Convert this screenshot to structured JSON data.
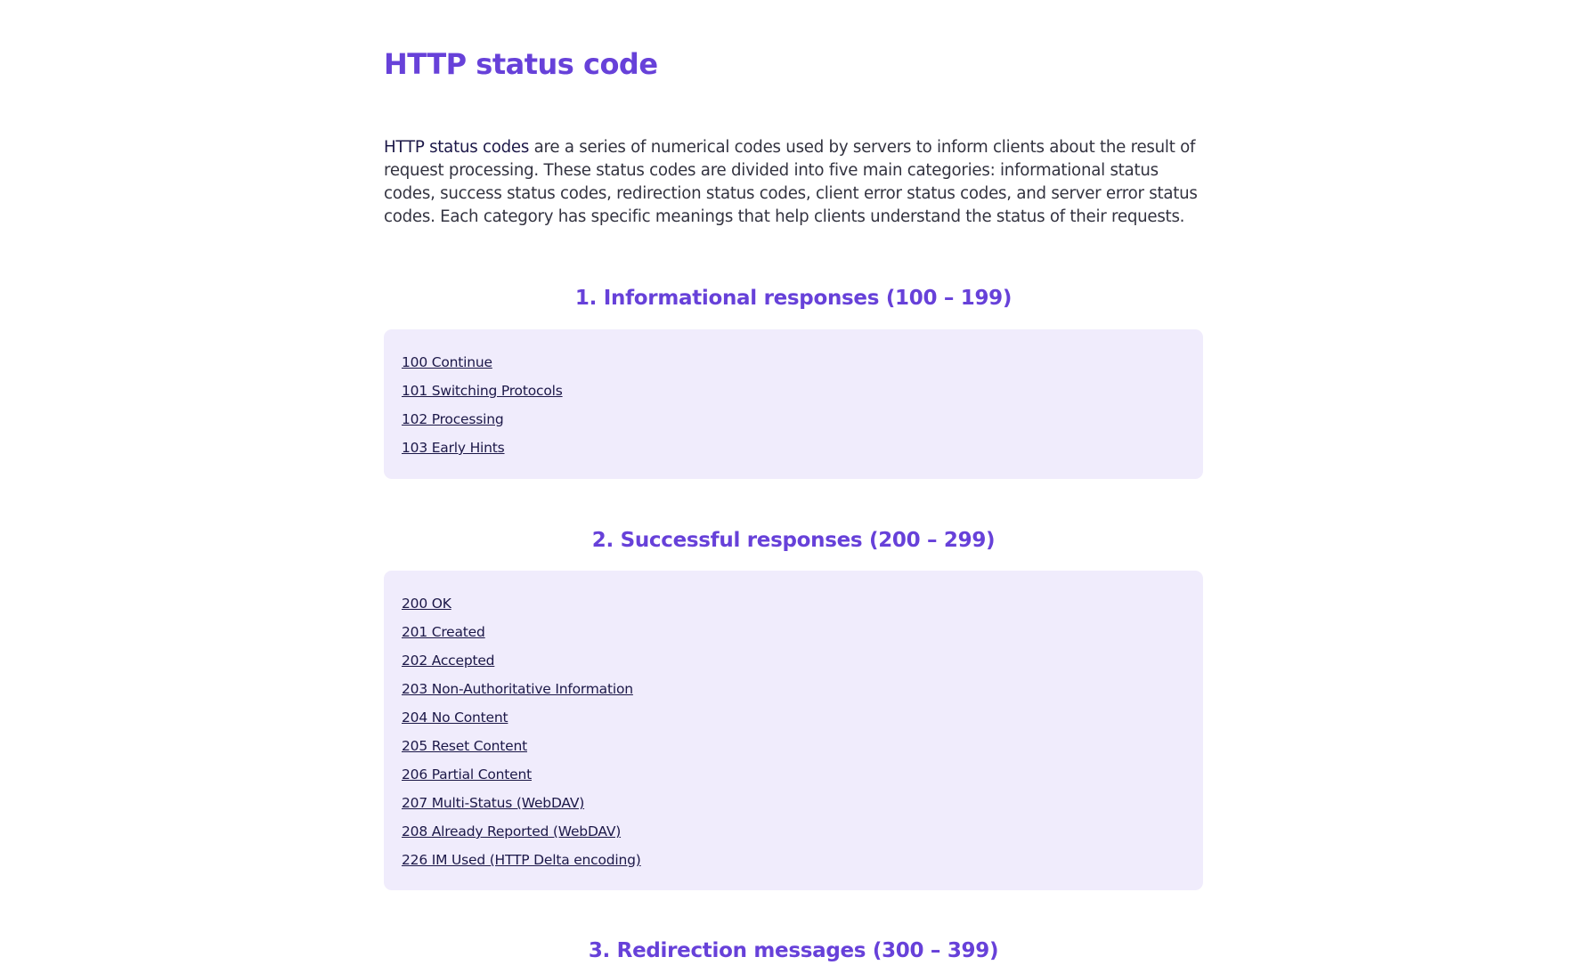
{
  "page": {
    "title": "HTTP status code",
    "intro": {
      "link_text": "HTTP status codes",
      "text": " are a series of numerical codes used by servers to inform clients about the result of request processing. These status codes are divided into five main categories: informational status codes, success status codes, redirection status codes, client error status codes, and server error status codes. Each category has specific meanings that help clients understand the status of their requests."
    }
  },
  "sections": [
    {
      "heading": "1. Informational responses (100 – 199)",
      "codes": [
        "100 Continue",
        "101 Switching Protocols",
        "102 Processing",
        "103 Early Hints"
      ]
    },
    {
      "heading": "2. Successful responses (200 – 299)",
      "codes": [
        "200 OK",
        "201 Created",
        "202 Accepted",
        "203 Non-Authoritative Information",
        "204 No Content",
        "205 Reset Content",
        "206 Partial Content",
        "207 Multi-Status (WebDAV)",
        "208 Already Reported (WebDAV)",
        "226 IM Used (HTTP Delta encoding)"
      ]
    },
    {
      "heading": "3. Redirection messages (300 – 399)"
    }
  ],
  "colors": {
    "accent": "#6741d9",
    "box_background": "#f0ecfc",
    "link": "#1c1848",
    "body_text": "#333340"
  }
}
